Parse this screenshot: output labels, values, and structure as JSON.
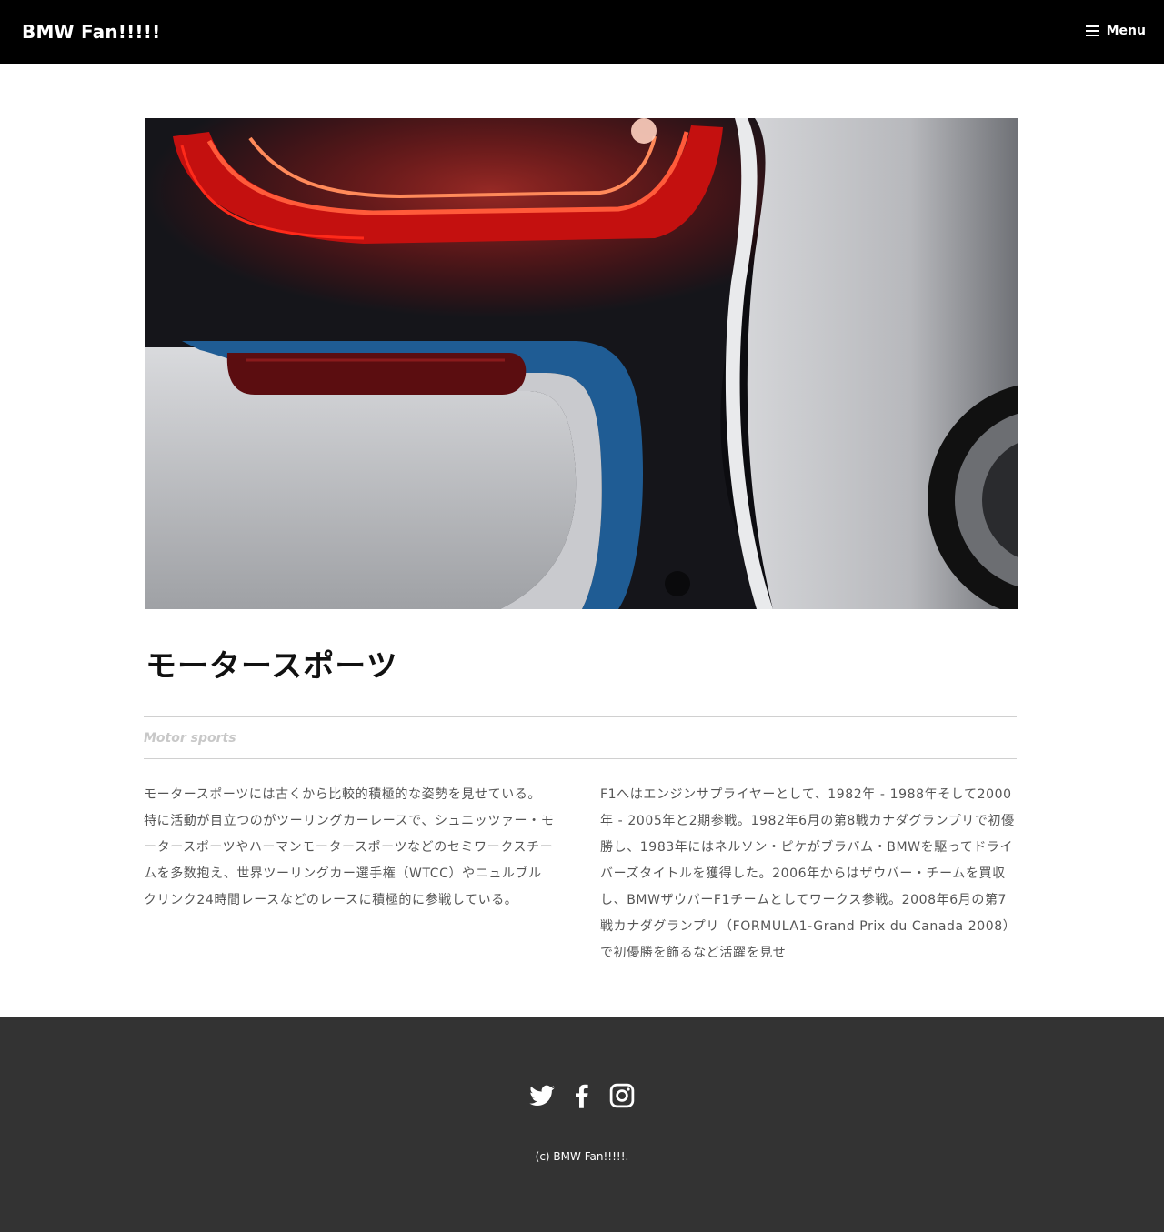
{
  "header": {
    "site_title": "BMW Fan!!!!!",
    "menu_label": "Menu"
  },
  "hero": {
    "image_alt": "BMW i8 rear taillight close-up"
  },
  "post": {
    "title": "モータースポーツ",
    "subtitle": "Motor sports",
    "col_left": "モータースポーツには古くから比較的積極的な姿勢を見せている。 特に活動が目立つのがツーリングカーレースで、シュニッツァー・モータースポーツやハーマンモータースポーツなどのセミワークスチームを多数抱え、世界ツーリングカー選手権（WTCC）やニュルブルクリンク24時間レースなどのレースに積極的に参戦している。",
    "col_right": "F1へはエンジンサプライヤーとして、1982年 - 1988年そして2000年 - 2005年と2期参戦。1982年6月の第8戦カナダグランプリで初優勝し、1983年にはネルソン・ピケがブラバム・BMWを駆ってドライバーズタイトルを獲得した。2006年からはザウバー・チームを買収し、BMWザウバーF1チームとしてワークス参戦。2008年6月の第7戦カナダグランプリ（FORMULA1-Grand Prix du Canada 2008）で初優勝を飾るなど活躍を見せ"
  },
  "footer": {
    "social": [
      "twitter-icon",
      "facebook-icon",
      "instagram-icon"
    ],
    "copyright": "(c) BMW Fan!!!!!."
  },
  "colors": {
    "header_bg": "#000000",
    "footer_bg": "#333333",
    "subtitle": "#c8c8c8"
  }
}
